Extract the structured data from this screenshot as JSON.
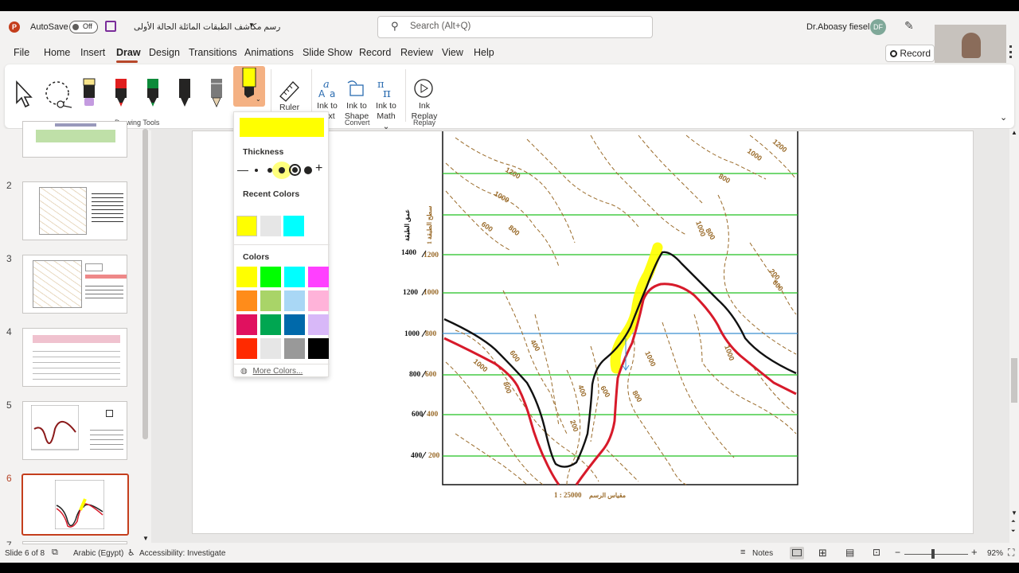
{
  "titlebar": {
    "autosave_label": "AutoSave",
    "autosave_state": "Off",
    "filename": "رسم مكاشف الطبقات المائلة الحالة الأولى",
    "search_placeholder": "Search (Alt+Q)",
    "user_name": "Dr.Aboasy fiesel",
    "user_initials": "DF"
  },
  "tabs": [
    "File",
    "Home",
    "Insert",
    "Draw",
    "Design",
    "Transitions",
    "Animations",
    "Slide Show",
    "Record",
    "Review",
    "View",
    "Help"
  ],
  "record_button": "Record",
  "ribbon": {
    "drawing_tools_label": "Drawing Tools",
    "ruler": "Ruler",
    "ink_to_text_1": "Ink to",
    "ink_to_text_2": "Text",
    "ink_to_shape_1": "Ink to",
    "ink_to_shape_2": "Shape",
    "ink_to_math_1": "Ink to",
    "ink_to_math_2": "Math",
    "convert_label": "Convert",
    "ink_replay_1": "Ink",
    "ink_replay_2": "Replay",
    "replay_label": "Replay"
  },
  "pen_menu": {
    "thickness_label": "Thickness",
    "recent_colors_label": "Recent Colors",
    "colors_label": "Colors",
    "more_colors": "More Colors...",
    "recent_colors": [
      "#ffff00",
      "#e6e6e6",
      "#00ffff"
    ],
    "colors": [
      "#ffff00",
      "#00ff00",
      "#00ffff",
      "#ff40ff",
      "#ff8c1a",
      "#a9d468",
      "#a9d7f5",
      "#ffb3d9",
      "#e0115f",
      "#00a651",
      "#0069aa",
      "#d8b8f8",
      "#ff2a00",
      "#e6e6e6",
      "#999999",
      "#000000"
    ]
  },
  "slides": {
    "numbers": [
      "2",
      "3",
      "4",
      "5",
      "6",
      "7"
    ],
    "active": "6"
  },
  "map": {
    "y_labels_left": [
      "1400",
      "1200",
      "1000",
      "800",
      "600",
      "400"
    ],
    "y_labels_right": [
      "1200",
      "1000",
      "800",
      "600",
      "400",
      "200"
    ],
    "contours": [
      "1200",
      "1000",
      "1000",
      "1200",
      "800",
      "600",
      "800",
      "600",
      "1000",
      "600",
      "400",
      "1000",
      "800",
      "400",
      "600",
      "200",
      "800",
      "1000",
      "1000",
      "800",
      "200"
    ],
    "axis_title_1": "عمق الطبقة",
    "axis_title_2": "سطح الطبقة 1",
    "scale_label": "مقياس الرسم",
    "scale_value": "1 : 25000"
  },
  "status": {
    "slide_info": "Slide 6 of 8",
    "language": "Arabic (Egypt)",
    "accessibility": "Accessibility: Investigate",
    "notes": "Notes",
    "zoom": "92%"
  }
}
